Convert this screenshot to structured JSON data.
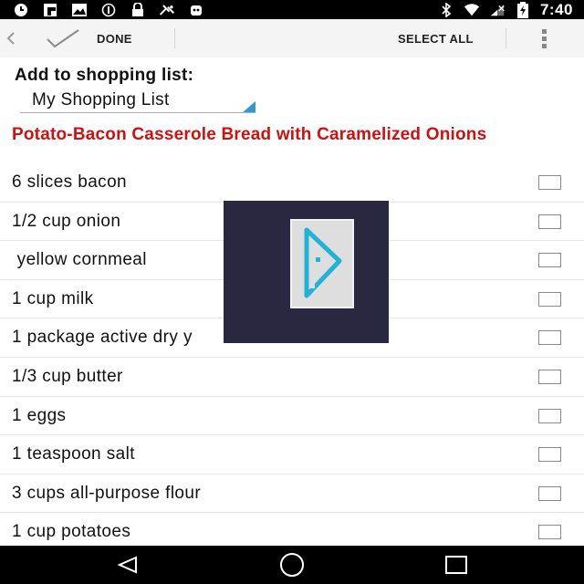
{
  "status_bar": {
    "time": "7:40",
    "left_icons": [
      "clock-icon",
      "flipboard-icon",
      "gallery-icon",
      "circle-icon",
      "lock-icon",
      "satellite-icon",
      "robot-icon"
    ],
    "right_icons": [
      "bluetooth-icon",
      "wifi-icon",
      "signal-icon",
      "battery-icon"
    ]
  },
  "action_bar": {
    "done_label": "DONE",
    "select_all_label": "SELECT ALL"
  },
  "header": {
    "add_to_label": "Add to shopping list:",
    "list_selected": "My Shopping List",
    "accent": "#3399cc"
  },
  "recipe": {
    "title": "Potato-Bacon Casserole Bread with Caramelized Onions",
    "title_color": "#cc1111"
  },
  "ingredients": [
    {
      "label": "6 slices bacon",
      "checked": false
    },
    {
      "label": "1/2 cup onion",
      "checked": false
    },
    {
      "label": " yellow cornmeal",
      "checked": false
    },
    {
      "label": "1 cup milk",
      "checked": false
    },
    {
      "label": "1 package active dry y",
      "checked": false
    },
    {
      "label": "1/3 cup butter",
      "checked": false
    },
    {
      "label": "1 eggs",
      "checked": false
    },
    {
      "label": "1 teaspoon salt",
      "checked": false
    },
    {
      "label": "3 cups all-purpose flour",
      "checked": false
    },
    {
      "label": "1 cup potatoes",
      "checked": false
    }
  ],
  "nav_bar": {
    "buttons": [
      "back-icon",
      "home-icon",
      "recents-icon"
    ]
  }
}
